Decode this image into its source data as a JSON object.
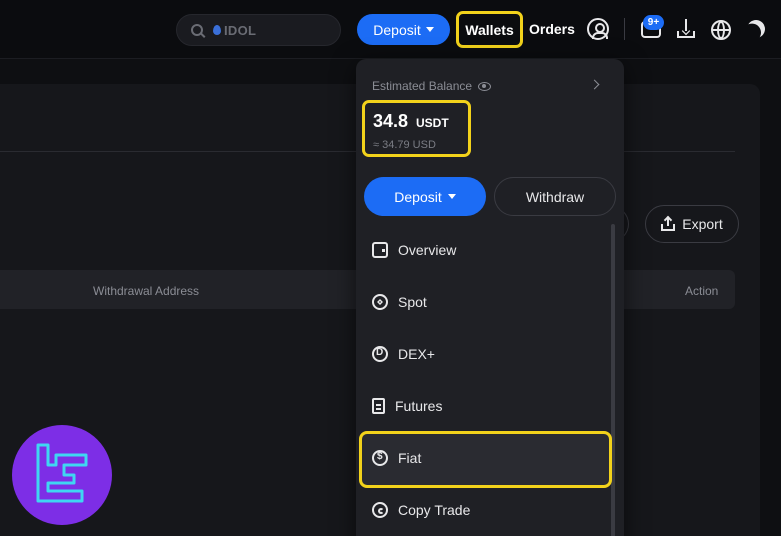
{
  "header": {
    "search_placeholder": "IDOL",
    "deposit_label": "Deposit",
    "wallets_label": "Wallets",
    "orders_label": "Orders",
    "notification_count": "9+"
  },
  "background": {
    "export_label": "Export",
    "table_headers": [
      "Withdrawal Address",
      "Action"
    ]
  },
  "wallet_menu": {
    "estimated_balance_label": "Estimated Balance",
    "balance_amount": "34.8",
    "balance_unit": "USDT",
    "balance_usd": "≈ 34.79 USD",
    "deposit_label": "Deposit",
    "withdraw_label": "Withdraw",
    "items": [
      {
        "label": "Overview",
        "icon": "wallet-icon"
      },
      {
        "label": "Spot",
        "icon": "spot-icon"
      },
      {
        "label": "DEX+",
        "icon": "dex-icon"
      },
      {
        "label": "Futures",
        "icon": "futures-icon"
      },
      {
        "label": "Fiat",
        "icon": "fiat-dollar-icon"
      },
      {
        "label": "Copy Trade",
        "icon": "copy-trade-icon"
      }
    ]
  },
  "colors": {
    "accent": "#1c6cf5",
    "highlight": "#f2d21b",
    "logo_bg": "#7d2ee6",
    "logo_stroke": "#3fd6f2"
  }
}
